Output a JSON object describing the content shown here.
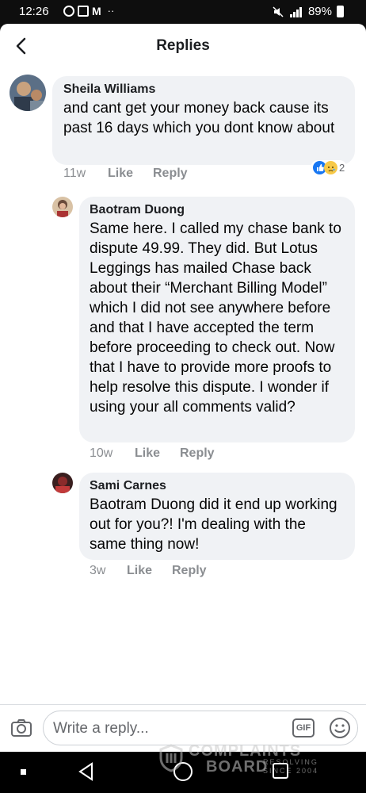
{
  "status_bar": {
    "time": "12:26",
    "app_icon_text": "M",
    "overflow": "··",
    "battery": "89%"
  },
  "header": {
    "title": "Replies"
  },
  "comments": [
    {
      "author": "Sheila Williams",
      "text": "and cant get your money back cause its past 16 days which you dont know about",
      "age": "11w",
      "like_label": "Like",
      "reply_label": "Reply",
      "reaction_count": "2",
      "reaction_icons": [
        "like-icon",
        "sad-icon"
      ]
    },
    {
      "author": "Baotram Duong",
      "text": "Same here. I called my chase bank to dispute 49.99. They did. But Lotus Leggings has mailed Chase back about their “Merchant Billing Model” which I did not see anywhere before and that I have accepted the term before proceeding to check out. Now that I have to provide more proofs to help resolve this dispute. I wonder if using your all comments valid?",
      "age": "10w",
      "like_label": "Like",
      "reply_label": "Reply"
    },
    {
      "author": "Sami Carnes",
      "text": "Baotram Duong did it end up working out for you?! I'm dealing with the same thing now!",
      "age": "3w",
      "like_label": "Like",
      "reply_label": "Reply"
    }
  ],
  "composer": {
    "placeholder": "Write a reply...",
    "gif_label": "GIF"
  },
  "watermark": {
    "line1": "COMPLAINTS",
    "line2": "BOARD",
    "tagline": "RESOLVING SINCE 2004"
  },
  "colors": {
    "bubble": "#f0f2f5",
    "like_blue": "#1877f2",
    "muted_text": "#8a8d91"
  }
}
